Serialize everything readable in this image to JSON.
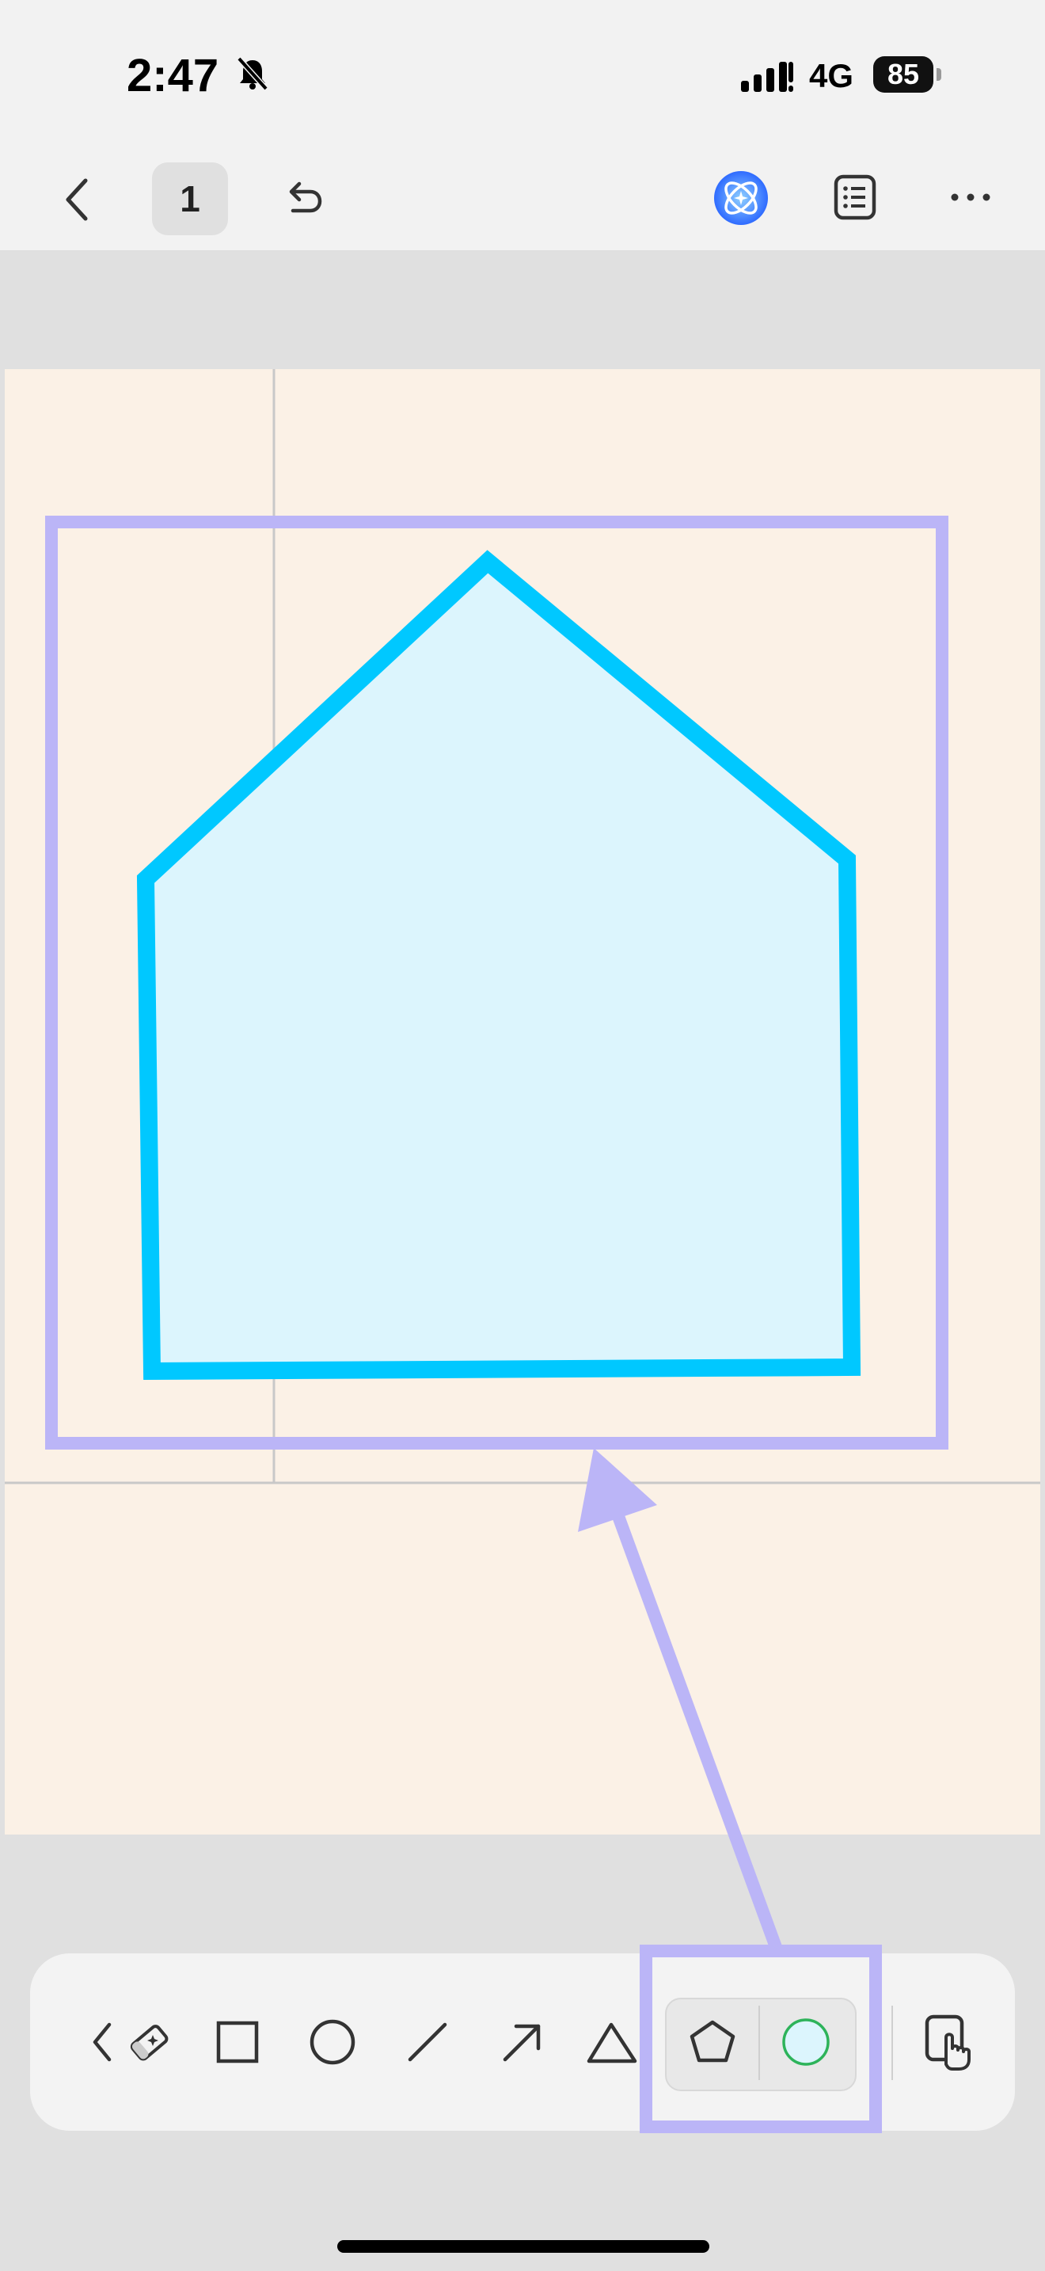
{
  "status_bar": {
    "time": "2:47",
    "network": "4G",
    "battery": "85"
  },
  "top_bar": {
    "page_number": "1",
    "icons": [
      "back-icon",
      "undo-icon",
      "ai-assistant-icon",
      "list-icon",
      "more-icon"
    ]
  },
  "canvas": {
    "background": "#fbf1e6",
    "shape": {
      "type": "pentagon",
      "stroke": "#00c8ff",
      "fill": "#dcf5fd"
    },
    "annotation_color": "#bbb5f7"
  },
  "toolbar": {
    "tools": [
      "collapse-icon",
      "eraser-icon",
      "rectangle-icon",
      "circle-icon",
      "line-icon",
      "arrow-icon",
      "triangle-icon",
      "pentagon-icon",
      "fill-color-icon",
      "touch-mode-icon"
    ],
    "selected_fill_color": "#dcf5fd"
  }
}
